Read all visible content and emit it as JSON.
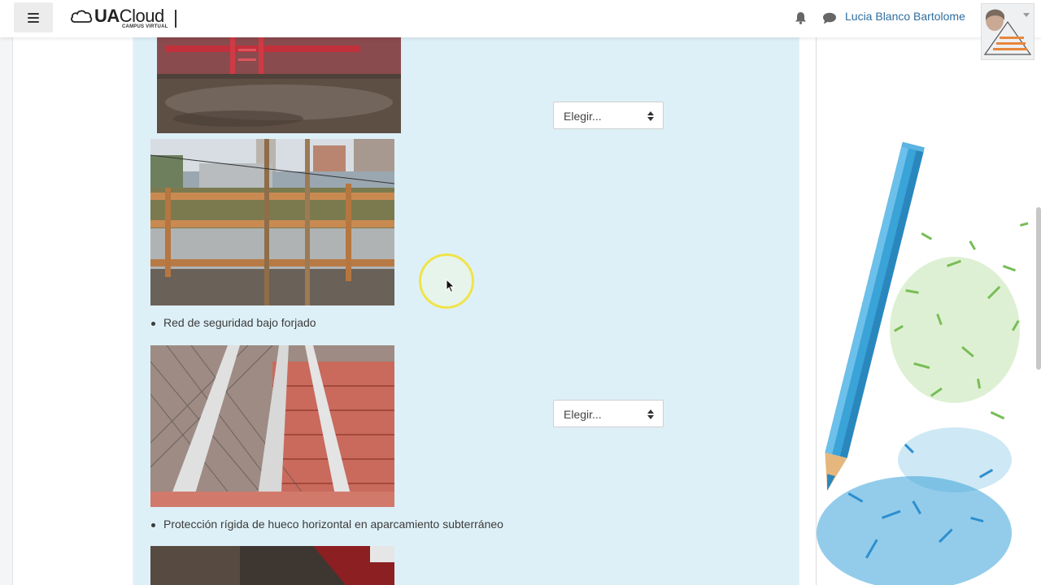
{
  "header": {
    "logo_main_bold": "UA",
    "logo_main_light": "Cloud",
    "logo_sub": "CAMPUS VIRTUAL",
    "user_name": "Lucia Blanco Bartolome",
    "icons": [
      "menu-icon",
      "cloud-icon",
      "bell-icon",
      "chat-icon",
      "avatar-image"
    ]
  },
  "quiz": {
    "items": [
      {
        "caption": "",
        "select_value": "Elegir..."
      },
      {
        "caption": "Red de seguridad bajo forjado",
        "select_value": ""
      },
      {
        "caption": "Protección rígida de hueco horizontal en aparcamiento subterráneo",
        "select_value": "Elegir..."
      }
    ]
  },
  "colors": {
    "panel_bg": "#def0f7",
    "link_blue": "#2f6e9f",
    "cursor_highlight": "#f0e34a",
    "pencil_blue": "#3aa3d8"
  }
}
